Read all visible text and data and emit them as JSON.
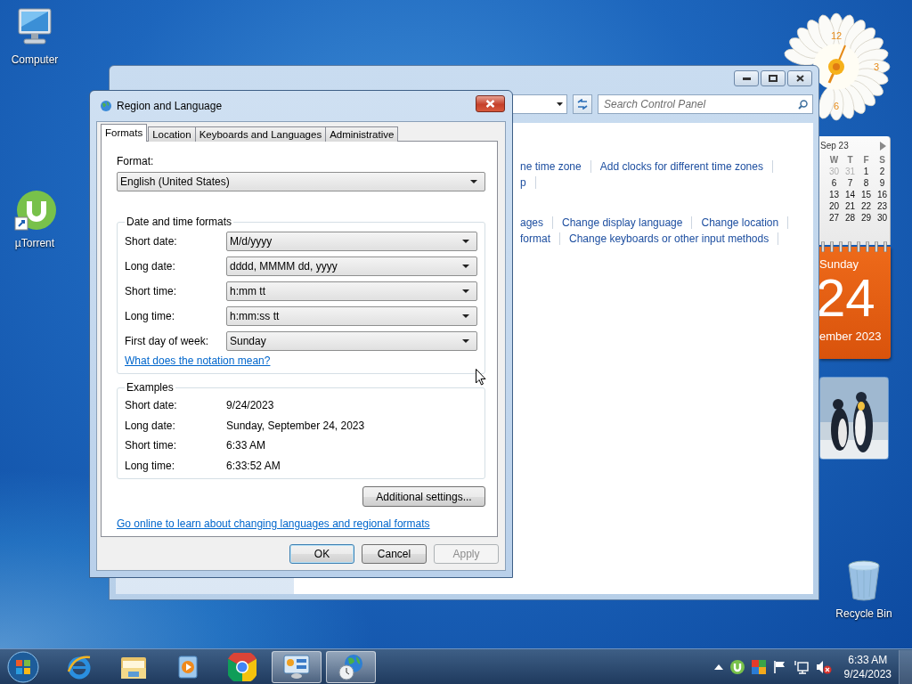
{
  "desktop_icons": [
    {
      "kind": "computer",
      "label": "Computer"
    },
    {
      "kind": "utorrent",
      "label": "µTorrent"
    },
    {
      "kind": "recycle",
      "label": "Recycle Bin"
    }
  ],
  "control_panel": {
    "search": {
      "placeholder": "Search Control Panel"
    },
    "link_rows": [
      [
        "ne time zone",
        "Add clocks for different time zones"
      ],
      [
        "p"
      ],
      [
        "ages",
        "Change display language",
        "Change location"
      ],
      [
        "format",
        "Change keyboards or other input methods"
      ]
    ]
  },
  "gadgets": {
    "clock": {
      "numerals": [
        "12",
        "3",
        "6"
      ]
    },
    "calendar": {
      "month": "Sep 23",
      "weekdays": [
        "W",
        "T",
        "F",
        "S"
      ],
      "weeks": [
        [
          {
            "day": "30",
            "other_month": true
          },
          {
            "day": "31",
            "other_month": true
          },
          {
            "day": "1",
            "other_month": false
          },
          {
            "day": "2",
            "other_month": false
          }
        ],
        [
          {
            "day": "6",
            "other_month": false
          },
          {
            "day": "7",
            "other_month": false
          },
          {
            "day": "8",
            "other_month": false
          },
          {
            "day": "9",
            "other_month": false
          }
        ],
        [
          {
            "day": "13",
            "other_month": false
          },
          {
            "day": "14",
            "other_month": false
          },
          {
            "day": "15",
            "other_month": false
          },
          {
            "day": "16",
            "other_month": false
          }
        ],
        [
          {
            "day": "20",
            "other_month": false
          },
          {
            "day": "21",
            "other_month": false
          },
          {
            "day": "22",
            "other_month": false
          },
          {
            "day": "23",
            "other_month": false
          }
        ],
        [
          {
            "day": "27",
            "other_month": false
          },
          {
            "day": "28",
            "other_month": false
          },
          {
            "day": "29",
            "other_month": false
          },
          {
            "day": "30",
            "other_month": false
          }
        ]
      ],
      "weekday": "Sunday",
      "date": "24",
      "month_year": "ember 2023"
    }
  },
  "dialog": {
    "title": "Region and Language",
    "tabs": [
      {
        "label": "Formats",
        "selected": true
      },
      {
        "label": "Location",
        "selected": false
      },
      {
        "label": "Keyboards and Languages",
        "selected": false
      },
      {
        "label": "Administrative",
        "selected": false
      }
    ],
    "format_label": "Format:",
    "format_value": "English (United States)",
    "date_time_group": {
      "title": "Date and time formats",
      "rows": [
        {
          "label": "Short date:",
          "value": "M/d/yyyy"
        },
        {
          "label": "Long date:",
          "value": "dddd, MMMM dd, yyyy"
        },
        {
          "label": "Short time:",
          "value": "h:mm tt"
        },
        {
          "label": "Long time:",
          "value": "h:mm:ss tt"
        },
        {
          "label": "First day of week:",
          "value": "Sunday"
        }
      ],
      "link": "What does the notation mean?"
    },
    "examples_group": {
      "title": "Examples",
      "rows": [
        {
          "label": "Short date:",
          "value": "9/24/2023"
        },
        {
          "label": "Long date:",
          "value": "Sunday, September 24, 2023"
        },
        {
          "label": "Short time:",
          "value": "6:33 AM"
        },
        {
          "label": "Long time:",
          "value": "6:33:52 AM"
        }
      ]
    },
    "additional_button": "Additional settings...",
    "online_link": "Go online to learn about changing languages and regional formats",
    "buttons": [
      {
        "label": "OK",
        "default": true,
        "disabled": false
      },
      {
        "label": "Cancel",
        "default": false,
        "disabled": false
      },
      {
        "label": "Apply",
        "default": false,
        "disabled": true
      }
    ]
  },
  "taskbar": {
    "apps": [
      {
        "kind": "ie",
        "running": false
      },
      {
        "kind": "explorer",
        "running": false
      },
      {
        "kind": "media",
        "running": false
      },
      {
        "kind": "chrome",
        "running": false
      },
      {
        "kind": "control-panel",
        "running": true
      },
      {
        "kind": "region",
        "running": true
      }
    ],
    "tray": [
      {
        "kind": "arrow"
      },
      {
        "kind": "utorrent"
      },
      {
        "kind": "grid"
      },
      {
        "kind": "flag"
      },
      {
        "kind": "network"
      },
      {
        "kind": "speaker-muted"
      }
    ],
    "time": "6:33 AM",
    "date": "9/24/2023"
  }
}
